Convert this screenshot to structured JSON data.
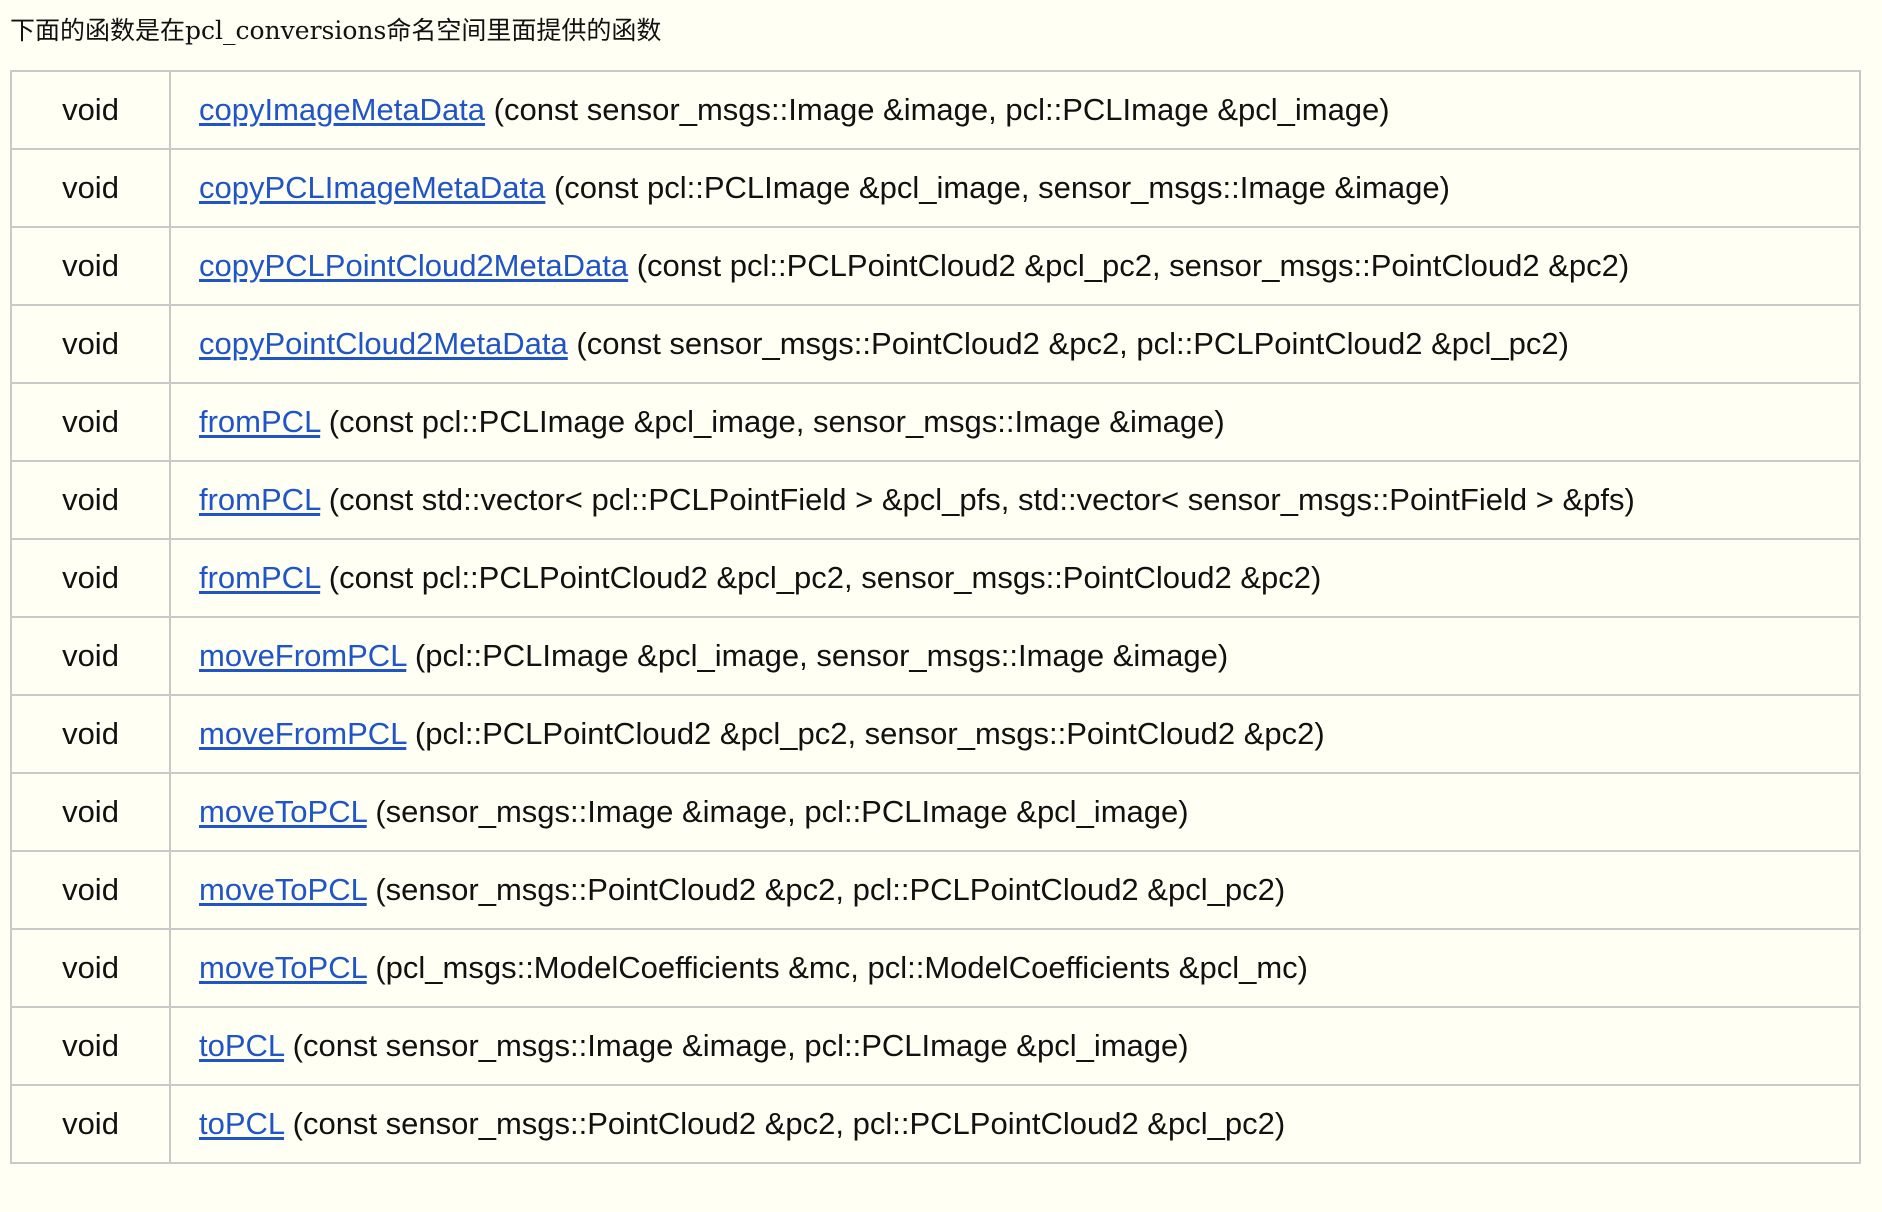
{
  "intro": "下面的函数是在pcl_conversions命名空间里面提供的函数",
  "functions": [
    {
      "ret": "void",
      "name": "copyImageMetaData",
      "params": "(const sensor_msgs::Image &image, pcl::PCLImage &pcl_image)"
    },
    {
      "ret": "void",
      "name": "copyPCLImageMetaData",
      "params": "(const pcl::PCLImage &pcl_image, sensor_msgs::Image &image)"
    },
    {
      "ret": "void",
      "name": "copyPCLPointCloud2MetaData",
      "params": "(const pcl::PCLPointCloud2 &pcl_pc2, sensor_msgs::PointCloud2 &pc2)"
    },
    {
      "ret": "void",
      "name": "copyPointCloud2MetaData",
      "params": "(const sensor_msgs::PointCloud2 &pc2, pcl::PCLPointCloud2 &pcl_pc2)"
    },
    {
      "ret": "void",
      "name": "fromPCL",
      "params": "(const pcl::PCLImage &pcl_image, sensor_msgs::Image &image)"
    },
    {
      "ret": "void",
      "name": "fromPCL",
      "params": "(const std::vector< pcl::PCLPointField > &pcl_pfs, std::vector< sensor_msgs::PointField > &pfs)"
    },
    {
      "ret": "void",
      "name": "fromPCL",
      "params": "(const pcl::PCLPointCloud2 &pcl_pc2, sensor_msgs::PointCloud2 &pc2)"
    },
    {
      "ret": "void",
      "name": "moveFromPCL",
      "params": "(pcl::PCLImage &pcl_image, sensor_msgs::Image &image)"
    },
    {
      "ret": "void",
      "name": "moveFromPCL",
      "params": "(pcl::PCLPointCloud2 &pcl_pc2, sensor_msgs::PointCloud2 &pc2)"
    },
    {
      "ret": "void",
      "name": "moveToPCL",
      "params": "(sensor_msgs::Image &image, pcl::PCLImage &pcl_image)"
    },
    {
      "ret": "void",
      "name": "moveToPCL",
      "params": "(sensor_msgs::PointCloud2 &pc2, pcl::PCLPointCloud2 &pcl_pc2)"
    },
    {
      "ret": "void",
      "name": "moveToPCL",
      "params": "(pcl_msgs::ModelCoefficients &mc, pcl::ModelCoefficients &pcl_mc)"
    },
    {
      "ret": "void",
      "name": "toPCL",
      "params": "(const sensor_msgs::Image &image, pcl::PCLImage &pcl_image)"
    },
    {
      "ret": "void",
      "name": "toPCL",
      "params": "(const sensor_msgs::PointCloud2 &pc2, pcl::PCLPointCloud2 &pcl_pc2)"
    }
  ],
  "colors": {
    "background": "#fffff4",
    "link": "#1f55c6",
    "border": "#c9c9c9",
    "text": "#111111"
  }
}
